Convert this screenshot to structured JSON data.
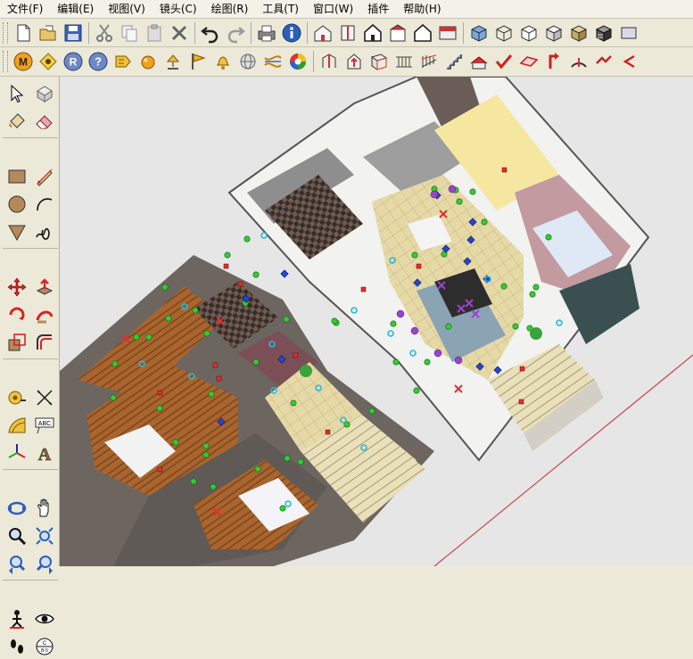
{
  "menu": {
    "items": [
      "文件(F)",
      "编辑(E)",
      "视图(V)",
      "镜头(C)",
      "绘图(R)",
      "工具(T)",
      "窗口(W)",
      "插件",
      "帮助(H)"
    ]
  },
  "toolbar1": {
    "groups": [
      [
        "new-file-icon",
        "open-file-icon",
        "save-icon"
      ],
      [
        "cut-icon",
        "copy-icon",
        "paste-icon",
        "erase-icon"
      ],
      [
        "undo-icon",
        "redo-icon"
      ],
      [
        "print-icon",
        "model-info-icon"
      ],
      [
        "iso-view-icon",
        "top-view-icon",
        "front-view-icon",
        "right-view-icon",
        "back-view-icon",
        "left-view-icon"
      ],
      [
        "xray-icon",
        "wireframe-icon",
        "hidden-line-icon",
        "shaded-icon",
        "shaded-texture-icon",
        "monochrome-icon"
      ]
    ]
  },
  "toolbar2": {
    "groups": [
      [
        "plugin-m-icon",
        "plugin-tag-icon",
        "plugin-r-icon",
        "help-icon",
        "plugin-key-icon",
        "sphere-icon",
        "lamp-icon",
        "flag-icon",
        "bell-icon",
        "globe-icon",
        "weave-icon",
        "color-wheel-icon"
      ],
      [
        "extrude-icon",
        "push-icon",
        "frame-icon",
        "rail-icon",
        "fence-icon",
        "stair-icon",
        "roof-icon",
        "check-icon",
        "plane-icon",
        "red-arrow-icon",
        "arc-tool-icon",
        "curve-icon"
      ]
    ]
  },
  "lefttools": {
    "rows": [
      [
        "select-icon",
        "component-icon"
      ],
      [
        "paint-bucket-icon",
        "eraser-icon"
      ],
      [
        "rectangle-icon",
        "pencil-icon"
      ],
      [
        "circle-icon",
        "arc-icon"
      ],
      [
        "polygon-icon",
        "freehand-icon"
      ],
      [
        "move-icon",
        "push-pull-icon"
      ],
      [
        "rotate-icon",
        "follow-me-icon"
      ],
      [
        "scale-icon",
        "offset-icon"
      ],
      [
        "tape-measure-icon",
        "dimension-icon"
      ],
      [
        "protractor-icon",
        "text-icon"
      ],
      [
        "axes-icon",
        "3d-text-icon"
      ],
      [
        "orbit-icon",
        "pan-icon"
      ],
      [
        "zoom-icon",
        "zoom-extents-icon"
      ],
      [
        "previous-view-icon",
        "next-view-icon"
      ],
      [
        "position-camera-icon",
        "look-around-icon"
      ],
      [
        "walk-icon",
        "section-plane-icon"
      ]
    ],
    "text_icon_label": "ABC",
    "section_label": "C\nB-5"
  },
  "viewport": {
    "background": "#e6e6e6",
    "axis_color": "#cc4444",
    "marker_colors": {
      "green": "#33cc33",
      "blue": "#2244dd",
      "red": "#e03030",
      "cyan": "#22bbdd",
      "purple": "#9944cc"
    }
  }
}
